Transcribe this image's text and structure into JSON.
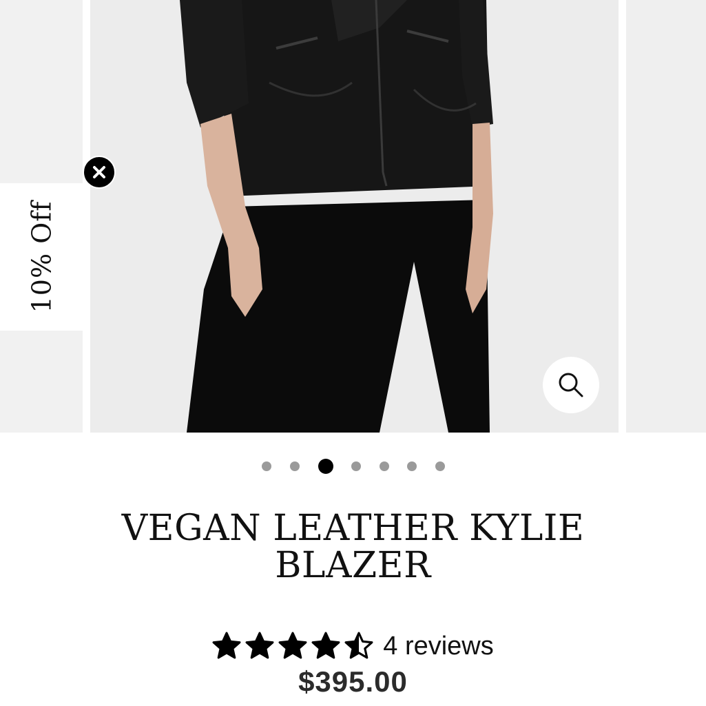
{
  "promo": {
    "tab_label": "10% Off"
  },
  "gallery": {
    "slide_count": 7,
    "active_index": 2
  },
  "product": {
    "title": "VEGAN LEATHER KYLIE BLAZER",
    "rating": 4.5,
    "rating_max": 5,
    "reviews_label": "4 reviews",
    "price": "$395.00"
  },
  "icons": {
    "close": "close-icon",
    "zoom": "magnifier-icon",
    "star": "star-icon"
  },
  "colors": {
    "text": "#111111",
    "dot_inactive": "#9a9a9a",
    "dot_active": "#000000"
  }
}
